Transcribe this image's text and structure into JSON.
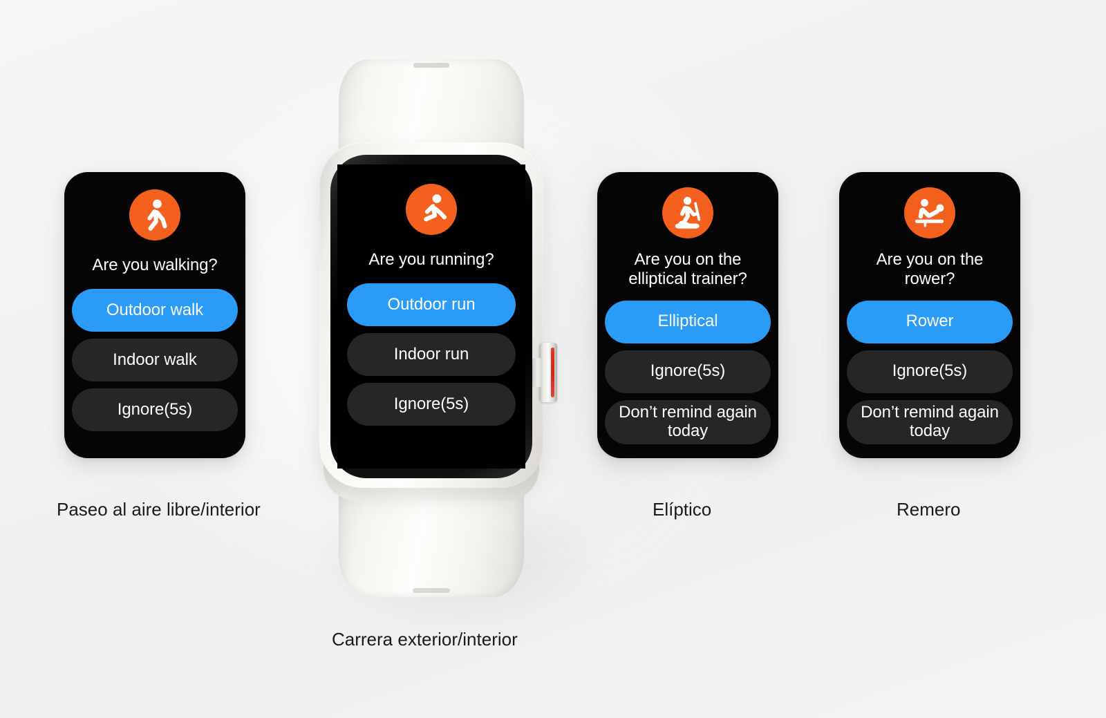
{
  "background": {
    "color": "#f4f4f4"
  },
  "theme": {
    "accent_orange": "#f4601e",
    "primary_blue": "#2a9bf7",
    "secondary_dark": "#262626",
    "screen_black": "#000000",
    "text_white": "#ffffff",
    "caption_text": "#1a1a1a"
  },
  "cards": [
    {
      "id": "walking",
      "icon": "walking-person-icon",
      "question": "Are you walking?",
      "options": [
        {
          "label": "Outdoor walk",
          "style": "primary"
        },
        {
          "label": "Indoor walk",
          "style": "secondary"
        },
        {
          "label": "Ignore(5s)",
          "style": "secondary"
        }
      ],
      "caption": "Paseo al aire libre/interior"
    },
    {
      "id": "running",
      "icon": "running-person-icon",
      "question": "Are you running?",
      "options": [
        {
          "label": "Outdoor run",
          "style": "primary"
        },
        {
          "label": "Indoor run",
          "style": "secondary"
        },
        {
          "label": "Ignore(5s)",
          "style": "secondary"
        }
      ],
      "caption": "Carrera exterior/interior"
    },
    {
      "id": "elliptical",
      "icon": "elliptical-trainer-icon",
      "question": "Are you on the elliptical trainer?",
      "options": [
        {
          "label": "Elliptical",
          "style": "primary"
        },
        {
          "label": "Ignore(5s)",
          "style": "secondary"
        },
        {
          "label": "Don’t remind again today",
          "style": "secondary"
        }
      ],
      "caption": "Elíptico"
    },
    {
      "id": "rower",
      "icon": "rowing-machine-icon",
      "question": "Are you on the rower?",
      "options": [
        {
          "label": "Rower",
          "style": "primary"
        },
        {
          "label": "Ignore(5s)",
          "style": "secondary"
        },
        {
          "label": "Don’t remind again today",
          "style": "secondary"
        }
      ],
      "caption": "Remero"
    }
  ],
  "device": {
    "name": "smart-band-watch",
    "case_color": "#fbfaf7",
    "strap_color": "#fcfbf8",
    "side_button_accent": "#d32f26"
  }
}
